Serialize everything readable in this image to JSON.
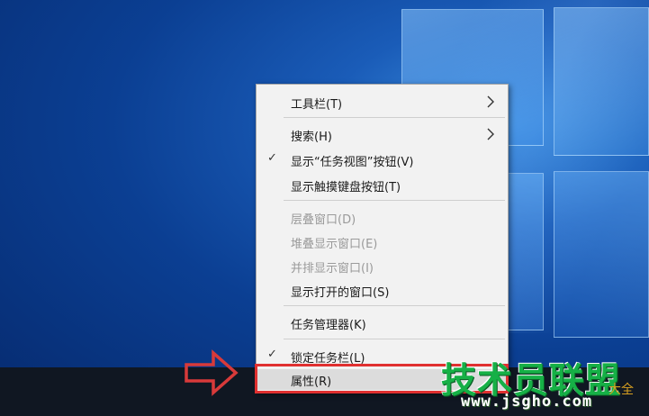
{
  "context_menu": {
    "items": [
      {
        "label": "工具栏(T)",
        "has_submenu": true,
        "checked": false,
        "disabled": false
      },
      {
        "label": "搜索(H)",
        "has_submenu": true,
        "checked": false,
        "disabled": false
      },
      {
        "label": "显示“任务视图”按钮(V)",
        "has_submenu": false,
        "checked": true,
        "disabled": false
      },
      {
        "label": "显示触摸键盘按钮(T)",
        "has_submenu": false,
        "checked": false,
        "disabled": false
      },
      {
        "label": "层叠窗口(D)",
        "has_submenu": false,
        "checked": false,
        "disabled": true
      },
      {
        "label": "堆叠显示窗口(E)",
        "has_submenu": false,
        "checked": false,
        "disabled": true
      },
      {
        "label": "并排显示窗口(I)",
        "has_submenu": false,
        "checked": false,
        "disabled": true
      },
      {
        "label": "显示打开的窗口(S)",
        "has_submenu": false,
        "checked": false,
        "disabled": false
      },
      {
        "label": "任务管理器(K)",
        "has_submenu": false,
        "checked": false,
        "disabled": false
      },
      {
        "label": "锁定任务栏(L)",
        "has_submenu": false,
        "checked": true,
        "disabled": false
      },
      {
        "label": "属性(R)",
        "has_submenu": false,
        "checked": false,
        "disabled": false,
        "highlighted": true
      }
    ],
    "check_glyph": "✓"
  },
  "watermark": {
    "title": "技术员联盟",
    "url": "www.jsgho.com",
    "corner_text": "大全"
  },
  "colors": {
    "highlight_box": "#e03030",
    "pointer_arrow": "#d83a3a",
    "watermark_green": "#16b046"
  },
  "icons": {
    "submenu": "chevron-right-icon",
    "check": "check-icon",
    "pointer": "pointer-arrow-icon"
  }
}
